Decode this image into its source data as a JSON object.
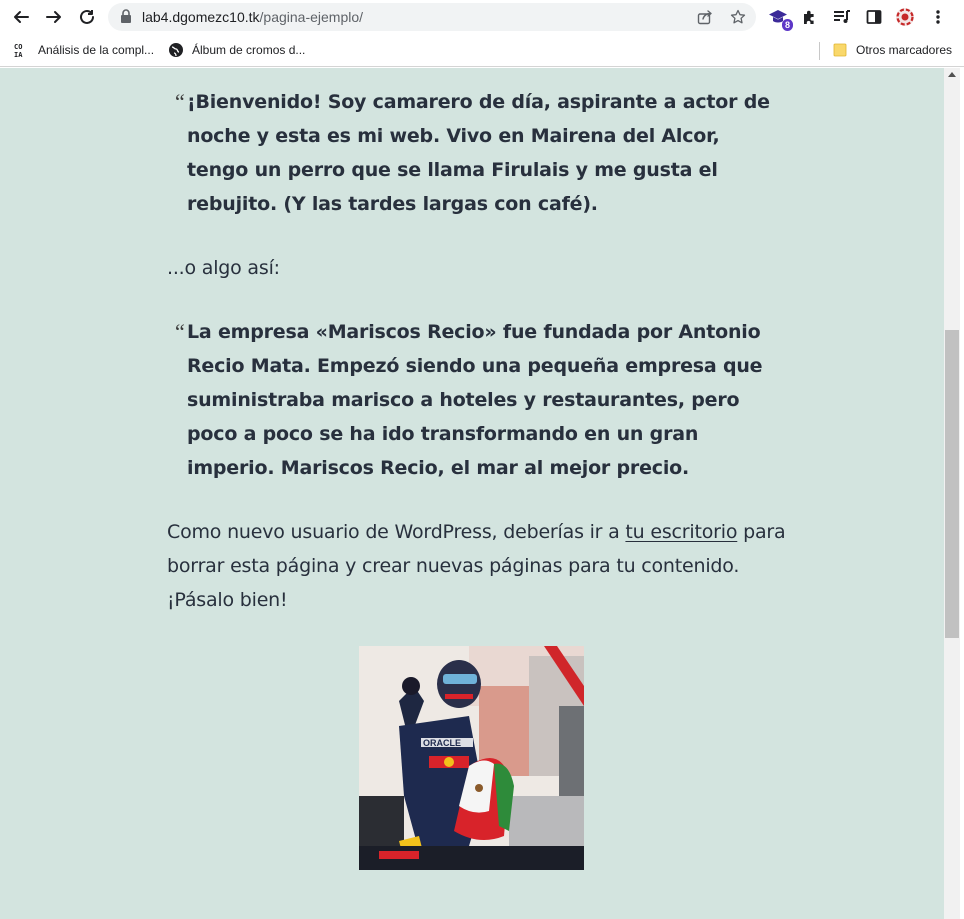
{
  "browser": {
    "url_domain": "lab4.dgomezc10.tk",
    "url_path": "/pagina-ejemplo/",
    "extension_badge": "8"
  },
  "bookmarks": {
    "items": [
      {
        "label": "Análisis de la compl...",
        "icon": "pagespeed-icon"
      },
      {
        "label": "Álbum de cromos d...",
        "icon": "globe-icon"
      }
    ],
    "other_folder": "Otros marcadores"
  },
  "content": {
    "quote1_mark": "“",
    "quote1": "¡Bienvenido! Soy camarero de día, aspirante a actor de noche y esta es mi web. Vivo en Mairena del Alcor, tengo un perro que se llama Firulais y me gusta el rebujito. (Y las tardes largas con café).",
    "middle_text": "...o algo así:",
    "quote2_mark": "“",
    "quote2": "La empresa «Mariscos Recio» fue fundada por Antonio Recio Mata. Empezó siendo una pequeña empresa que suministraba marisco a hoteles y restaurantes, pero poco a poco se ha ido transformando en un gran imperio. Mariscos Recio, el mar al mejor precio.",
    "para_before": "Como nuevo usuario de WordPress, deberías ir a ",
    "para_link": "tu escritorio",
    "para_after": " para borrar esta página y crear nuevas páginas para tu contenido. ¡Pásalo bien!",
    "photo_logo_text": "ORACLE"
  },
  "colors": {
    "page_background": "#d3e4df",
    "text": "#28303d",
    "badge": "#5d37c7"
  }
}
